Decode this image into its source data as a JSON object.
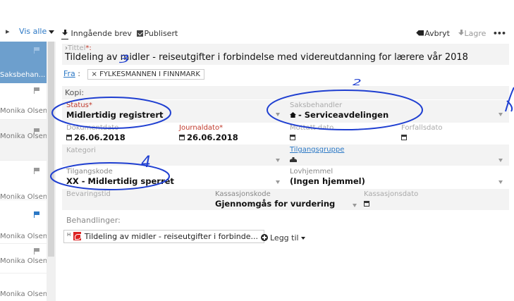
{
  "left_panel": {
    "view_all": "Vis alle",
    "header_label": "Saksbehan...",
    "rows": [
      {
        "name": "Monika Olsen",
        "flag": "gray"
      },
      {
        "name": "Monika Olsen",
        "flag": "gray"
      },
      {
        "name": "Monika Olsen",
        "flag": "gray"
      },
      {
        "name": "Monika Olsen",
        "flag": "blue"
      },
      {
        "name": "Monika Olsen",
        "flag": "gray"
      },
      {
        "name": "Monika Olsen",
        "flag": "none"
      }
    ]
  },
  "toolbar": {
    "incoming": "Inngående brev",
    "published": "Publisert",
    "cancel": "Avbryt",
    "save": "Lagre",
    "more": "•••"
  },
  "form": {
    "title_label": "Tittel",
    "title_required": "*:",
    "title_value": "Tildeling av midler - reiseutgifter i forbindelse med videreutdanning for lærere vår 2018",
    "from_label": "Fra",
    "from_colon": ":",
    "from_tag": "FYLKESMANNEN I FINNMARK",
    "copy_label": "Kopi:",
    "status_label": "Status*",
    "status_value": "Midlertidig registrert",
    "case_handler_label": "Saksbehandler",
    "case_handler_value": "- Serviceavdelingen",
    "doc_date_label": "Dokumentdato",
    "doc_date_value": "26.06.2018",
    "journal_date_label": "Journaldato*",
    "journal_date_value": "26.06.2018",
    "received_date_label": "Mottatt dato",
    "due_date_label": "Forfallsdato",
    "category_label": "Kategori",
    "access_group_label": "Tilgangsgruppe",
    "access_code_label": "Tilgangskode",
    "access_code_value": "XX - Midlertidig sperret",
    "legal_basis_label": "Lovhjemmel",
    "legal_basis_value": "(Ingen hjemmel)",
    "retention_label": "Bevaringstid",
    "disposal_code_label": "Kassasjonskode",
    "disposal_code_value": "Gjennomgås for vurdering",
    "disposal_date_label": "Kassasjonsdato",
    "handlings_label": "Behandlinger:",
    "doc_prefix": "H",
    "doc_chip": "Tildeling av midler - reiseutgifter i forbinde...",
    "add_label": "Legg til"
  },
  "annotations": [
    "2",
    "3",
    "4"
  ]
}
